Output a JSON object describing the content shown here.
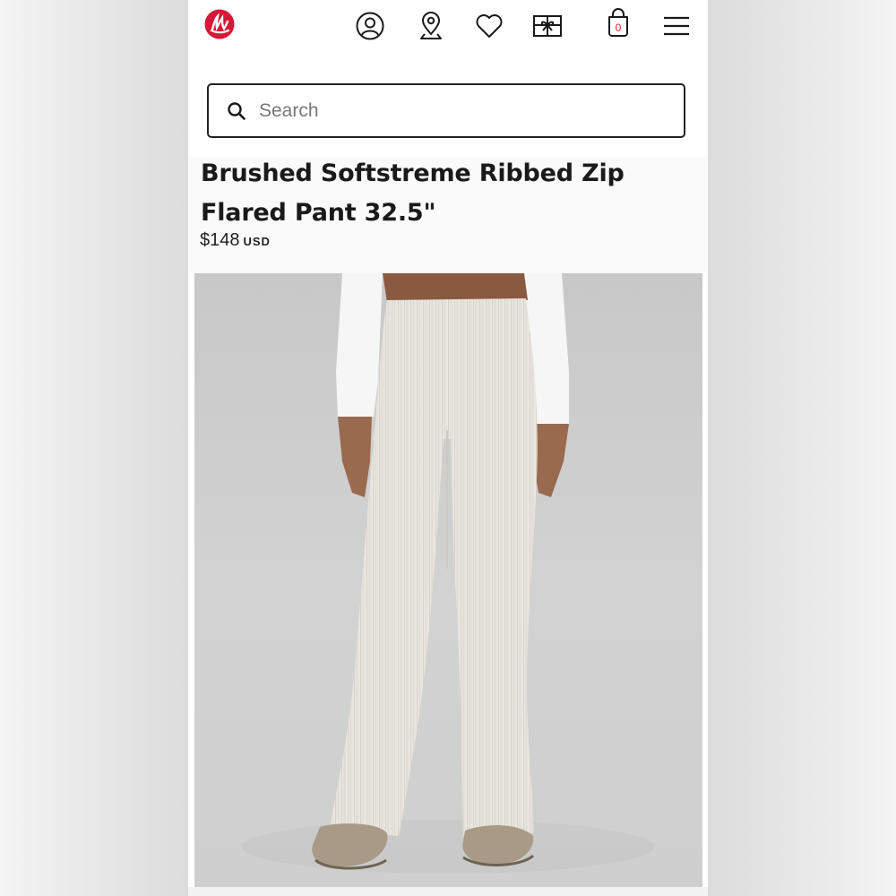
{
  "brand": {
    "logo": "lululemon-logo",
    "accent_color": "#d31a38"
  },
  "nav": {
    "icons": [
      "account-icon",
      "store-locator-icon",
      "wishlist-heart-icon",
      "gift-card-icon",
      "shopping-bag-icon",
      "menu-hamburger-icon"
    ],
    "bag_count": "0"
  },
  "search": {
    "placeholder": "Search",
    "value": ""
  },
  "product": {
    "title": "Brushed Softstreme Ribbed Zip Flared Pant 32.5\"",
    "price": "$148",
    "currency": "USD"
  }
}
